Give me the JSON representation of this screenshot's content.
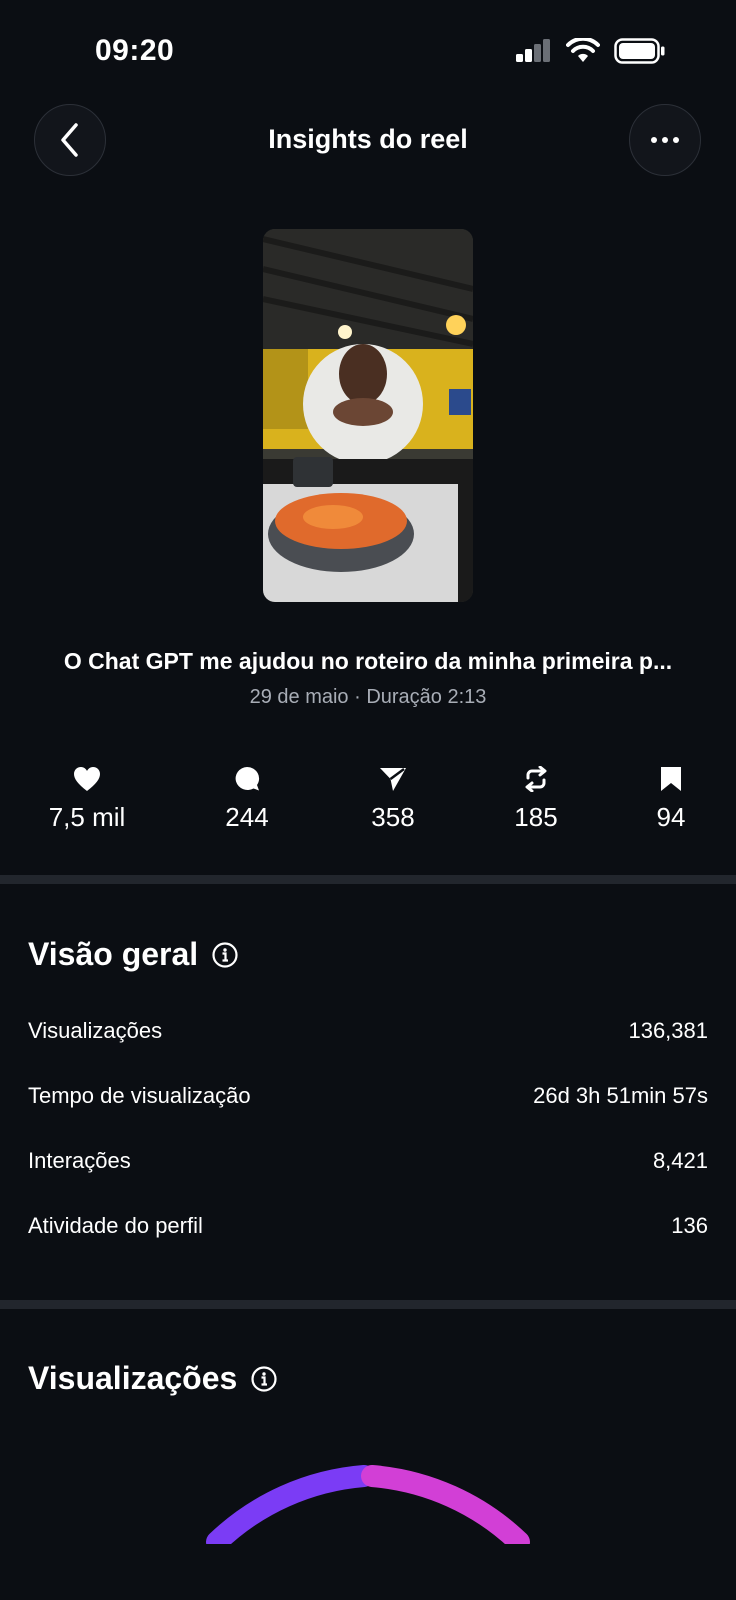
{
  "status_bar": {
    "time": "09:20"
  },
  "header": {
    "title": "Insights do reel"
  },
  "reel": {
    "caption": "O Chat GPT me ajudou no roteiro da minha primeira p...",
    "meta": "29 de maio · Duração 2:13"
  },
  "stats": [
    {
      "icon": "heart-icon",
      "value": "7,5 mil"
    },
    {
      "icon": "comment-icon",
      "value": "244"
    },
    {
      "icon": "share-icon",
      "value": "358"
    },
    {
      "icon": "repost-icon",
      "value": "185"
    },
    {
      "icon": "bookmark-icon",
      "value": "94"
    }
  ],
  "overview": {
    "title": "Visão geral",
    "rows": [
      {
        "label": "Visualizações",
        "value": "136,381"
      },
      {
        "label": "Tempo de visualização",
        "value": "26d 3h 51min 57s"
      },
      {
        "label": "Interações",
        "value": "8,421"
      },
      {
        "label": "Atividade do perfil",
        "value": "136"
      }
    ]
  },
  "views_section": {
    "title": "Visualizações"
  },
  "colors": {
    "background": "#0b0e13",
    "arc_purple": "#7b3cf5",
    "arc_pink": "#d23fd6"
  }
}
